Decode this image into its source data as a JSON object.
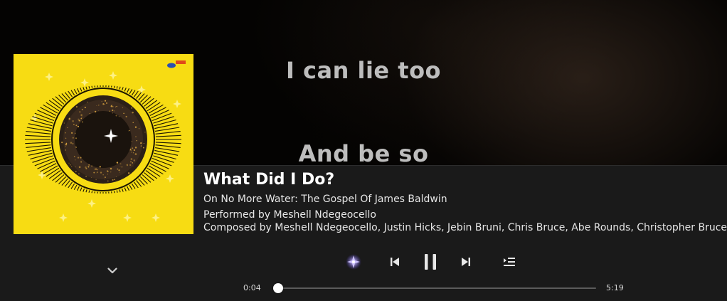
{
  "lyrics": {
    "lines": [
      "I can lie too",
      "And be so"
    ]
  },
  "track": {
    "title": "What Did I Do?",
    "album": "On No More Water: The Gospel Of James Baldwin",
    "performed": "Performed by Meshell Ndegeocello",
    "composed": "Composed by Meshell Ndegeocello, Justin Hicks, Jebin Bruni, Chris Bruce, Abe Rounds, Christopher Bruce"
  },
  "playback": {
    "current_time": "0:04",
    "total_time": "5:19",
    "progress_fraction": 0.0125,
    "state": "playing"
  },
  "icons": {
    "sparkle": "sparkle-icon",
    "previous": "skip-previous-icon",
    "pause": "pause-icon",
    "next": "skip-next-icon",
    "queue": "queue-icon",
    "collapse": "chevron-down-icon"
  },
  "colors": {
    "panel": "#1a1a1a",
    "album_yellow": "#f7dc13",
    "sparkle_accent": "#8a78ff"
  }
}
